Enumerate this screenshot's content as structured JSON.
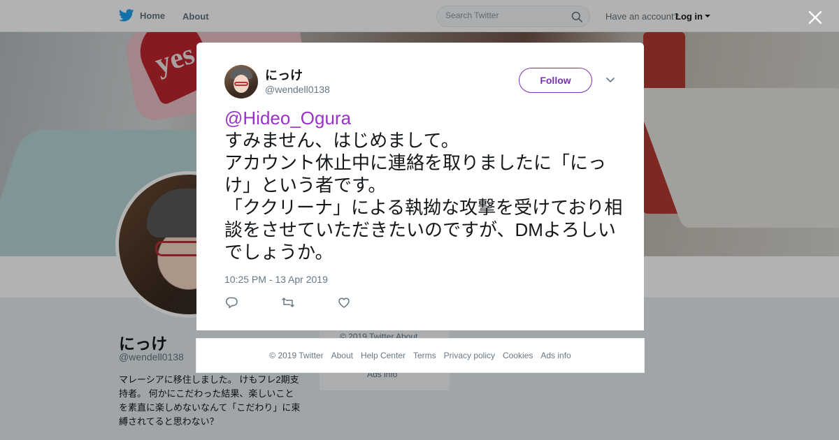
{
  "nav": {
    "home_label": "Home",
    "about_label": "About",
    "search_placeholder": "Search Twitter",
    "account_prompt": "Have an account?",
    "login_label": "Log in"
  },
  "banner": {
    "pillow_text": "yes"
  },
  "profile": {
    "name": "にっけ",
    "handle": "@wendell0138",
    "bio": "マレーシアに移住しました。 けもフレ2期支持者。 何かにこだわった結果、楽しいことを素直に楽しめないなんて「こだわり」に束縛されてると思わない？"
  },
  "side_card": {
    "copyright": "© 2019 Twitter   About",
    "ads_info": "Ads info"
  },
  "tweet": {
    "author_name": "にっけ",
    "author_handle": "@wendell0138",
    "follow_label": "Follow",
    "mention": "@Hideo_Ogura",
    "body": "すみません、はじめまして。\nアカウント休止中に連絡を取りましたに「にっけ」という者です。\n「ククリーナ」による執拗な攻撃を受けており相談をさせていただきたいのですが、DMよろしいでしょうか。",
    "timestamp": "10:25 PM - 13 Apr 2019"
  },
  "footer": {
    "copyright": "© 2019 Twitter",
    "about": "About",
    "help_center": "Help Center",
    "terms": "Terms",
    "privacy": "Privacy policy",
    "cookies": "Cookies",
    "ads_info": "Ads info"
  },
  "colors": {
    "accent_purple": "#7b2fb6",
    "mention_purple": "#9932c8",
    "twitter_blue": "#1da1f2",
    "muted_text": "#657786"
  },
  "icons": [
    "twitter-bird-icon",
    "search-icon",
    "close-icon",
    "chevron-down-icon",
    "reply-icon",
    "retweet-icon",
    "like-icon"
  ]
}
